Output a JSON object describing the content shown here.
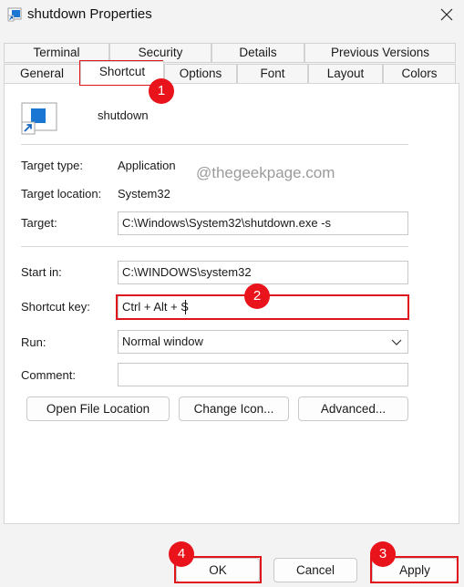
{
  "window": {
    "title": "shutdown Properties",
    "close_icon": "close-icon",
    "app_icon": "shortcut-app-icon"
  },
  "tabs": {
    "row1": [
      {
        "label": "Terminal"
      },
      {
        "label": "Security"
      },
      {
        "label": "Details"
      },
      {
        "label": "Previous Versions"
      }
    ],
    "row2": [
      {
        "label": "General"
      },
      {
        "label": "Shortcut",
        "active": true
      },
      {
        "label": "Options"
      },
      {
        "label": "Font"
      },
      {
        "label": "Layout"
      },
      {
        "label": "Colors"
      }
    ]
  },
  "shortcut": {
    "name": "shutdown",
    "target_type_label": "Target type:",
    "target_type_value": "Application",
    "target_location_label": "Target location:",
    "target_location_value": "System32",
    "target_label": "Target:",
    "target_value": "C:\\Windows\\System32\\shutdown.exe -s",
    "start_in_label": "Start in:",
    "start_in_value": "C:\\WINDOWS\\system32",
    "shortcut_key_label": "Shortcut key:",
    "shortcut_key_value": "Ctrl + Alt + S",
    "run_label": "Run:",
    "run_value": "Normal window",
    "comment_label": "Comment:",
    "comment_value": ""
  },
  "buttons": {
    "open_file_location": "Open File Location",
    "change_icon": "Change Icon...",
    "advanced": "Advanced...",
    "ok": "OK",
    "cancel": "Cancel",
    "apply": "Apply"
  },
  "watermark": "@thegeekpage.com",
  "annotations": [
    "1",
    "2",
    "3",
    "4"
  ],
  "colors": {
    "annotation_red": "#e0141a",
    "panel_bg": "#ffffff",
    "window_bg": "#f3f3f3"
  }
}
